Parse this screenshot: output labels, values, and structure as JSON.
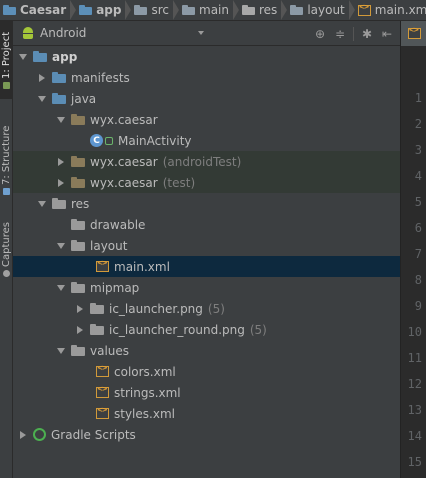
{
  "breadcrumb": [
    {
      "label": "Caesar",
      "icon": "folder-icon",
      "bold": true
    },
    {
      "label": "app",
      "icon": "folder-icon",
      "bold": true
    },
    {
      "label": "src",
      "icon": "folder-icon",
      "bold": false
    },
    {
      "label": "main",
      "icon": "folder-icon",
      "bold": false
    },
    {
      "label": "res",
      "icon": "res-folder-icon",
      "bold": false
    },
    {
      "label": "layout",
      "icon": "folder-icon",
      "bold": false
    },
    {
      "label": "main.xml",
      "icon": "xml-file-icon",
      "bold": false
    }
  ],
  "side_tabs": [
    {
      "label": "1: Project",
      "icon": "project-icon",
      "active": true
    },
    {
      "label": "7: Structure",
      "icon": "structure-icon",
      "active": false
    },
    {
      "label": "Captures",
      "icon": "captures-icon",
      "active": false
    }
  ],
  "project_panel": {
    "view_mode": "Android",
    "toolbar_icons": [
      "scroll-from-source-icon",
      "collapse-all-icon",
      "gear-icon",
      "hide-icon"
    ]
  },
  "tree": [
    {
      "label": "app",
      "icon": "module-folder-icon",
      "expanded": true,
      "bold": true
    },
    {
      "label": "manifests",
      "icon": "folder-icon",
      "expanded": false
    },
    {
      "label": "java",
      "icon": "folder-icon",
      "expanded": true
    },
    {
      "label": "wyx.caesar",
      "icon": "package-icon",
      "expanded": true
    },
    {
      "label": "MainActivity",
      "icon": "class-icon",
      "leaf": true
    },
    {
      "label": "wyx.caesar",
      "hint": "(androidTest)",
      "icon": "package-icon",
      "expanded": false
    },
    {
      "label": "wyx.caesar",
      "hint": "(test)",
      "icon": "package-icon",
      "expanded": false
    },
    {
      "label": "res",
      "icon": "res-folder-icon",
      "expanded": true
    },
    {
      "label": "drawable",
      "icon": "folder-icon",
      "leaf": true
    },
    {
      "label": "layout",
      "icon": "folder-icon",
      "expanded": true
    },
    {
      "label": "main.xml",
      "icon": "xml-file-icon",
      "leaf": true,
      "selected": true
    },
    {
      "label": "mipmap",
      "icon": "folder-icon",
      "expanded": true
    },
    {
      "label": "ic_launcher.png",
      "hint": "(5)",
      "icon": "folder-icon",
      "expanded": false
    },
    {
      "label": "ic_launcher_round.png",
      "hint": "(5)",
      "icon": "folder-icon",
      "expanded": false
    },
    {
      "label": "values",
      "icon": "folder-icon",
      "expanded": true
    },
    {
      "label": "colors.xml",
      "icon": "xml-file-icon",
      "leaf": true
    },
    {
      "label": "strings.xml",
      "icon": "xml-file-icon",
      "leaf": true
    },
    {
      "label": "styles.xml",
      "icon": "xml-file-icon",
      "leaf": true
    },
    {
      "label": "Gradle Scripts",
      "icon": "gradle-icon",
      "expanded": false
    }
  ],
  "editor": {
    "line_numbers": [
      "1",
      "2",
      "3",
      "4",
      "5",
      "6",
      "7",
      "8",
      "9",
      "10",
      "11",
      "12",
      "13",
      "14",
      "15"
    ]
  },
  "colors": {
    "background": "#3c3f41",
    "selection": "#0d293e",
    "editor_bg": "#2b2b2b"
  }
}
